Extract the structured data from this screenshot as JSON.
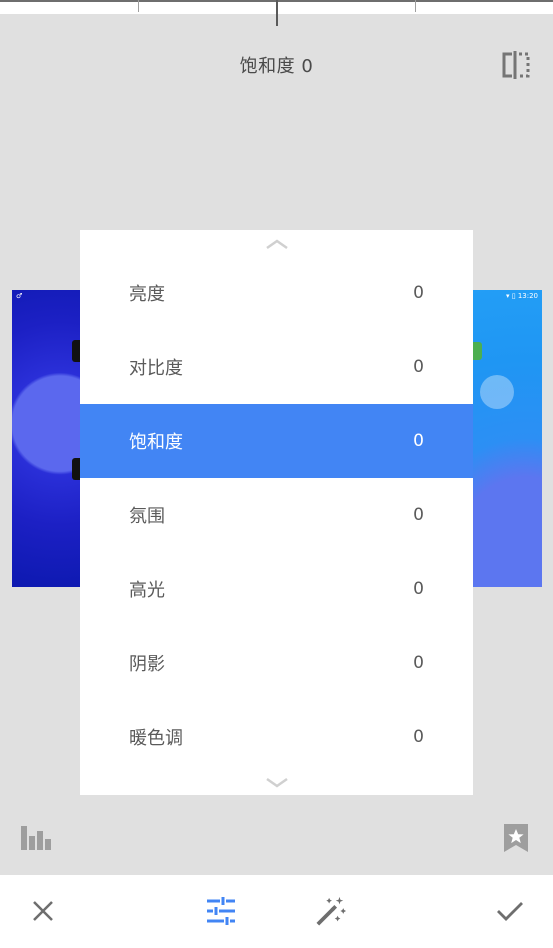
{
  "header": {
    "title": "饱和度 0"
  },
  "background": {
    "left_preview_status": "♂",
    "right_preview_status": "▾ ▯ 13:20"
  },
  "menu": {
    "items": [
      {
        "label": "亮度",
        "value": "0",
        "selected": false
      },
      {
        "label": "对比度",
        "value": "0",
        "selected": false
      },
      {
        "label": "饱和度",
        "value": "0",
        "selected": true
      },
      {
        "label": "氛围",
        "value": "0",
        "selected": false
      },
      {
        "label": "高光",
        "value": "0",
        "selected": false
      },
      {
        "label": "阴影",
        "value": "0",
        "selected": false
      },
      {
        "label": "暖色调",
        "value": "0",
        "selected": false
      }
    ]
  },
  "icons": {
    "compare": "compare-icon",
    "histogram": "histogram-icon",
    "bookmark": "bookmark-star-icon",
    "close": "close-icon",
    "tune": "tune-icon",
    "magic": "magic-wand-icon",
    "apply": "check-icon"
  },
  "colors": {
    "accent": "#4285f4",
    "icon_gray": "#757575",
    "background": "#e0e0e0"
  }
}
